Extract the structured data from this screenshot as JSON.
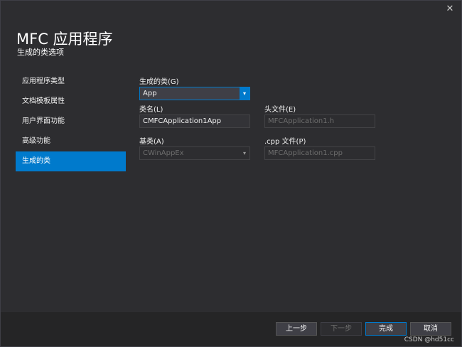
{
  "window": {
    "close_glyph": "✕",
    "title": "MFC 应用程序",
    "subtitle": "生成的类选项"
  },
  "sidebar": {
    "items": [
      {
        "label": "应用程序类型",
        "active": false
      },
      {
        "label": "文档模板属性",
        "active": false
      },
      {
        "label": "用户界面功能",
        "active": false
      },
      {
        "label": "高级功能",
        "active": false
      },
      {
        "label": "生成的类",
        "active": true
      }
    ]
  },
  "form": {
    "generated_class_label": "生成的类(G)",
    "generated_class_value": "App",
    "class_name_label": "类名(L)",
    "class_name_value": "CMFCApplication1App",
    "header_file_label": "头文件(E)",
    "header_file_value": "MFCApplication1.h",
    "base_class_label": "基类(A)",
    "base_class_value": "CWinAppEx",
    "cpp_file_label": ".cpp 文件(P)",
    "cpp_file_value": "MFCApplication1.cpp",
    "dropdown_arrow": "▾"
  },
  "footer": {
    "back_label": "上一步",
    "next_label": "下一步",
    "finish_label": "完成",
    "cancel_label": "取消",
    "watermark": "CSDN @hd51cc"
  },
  "colors": {
    "background": "#2d2d30",
    "accent": "#007acc",
    "footer": "#252526"
  }
}
